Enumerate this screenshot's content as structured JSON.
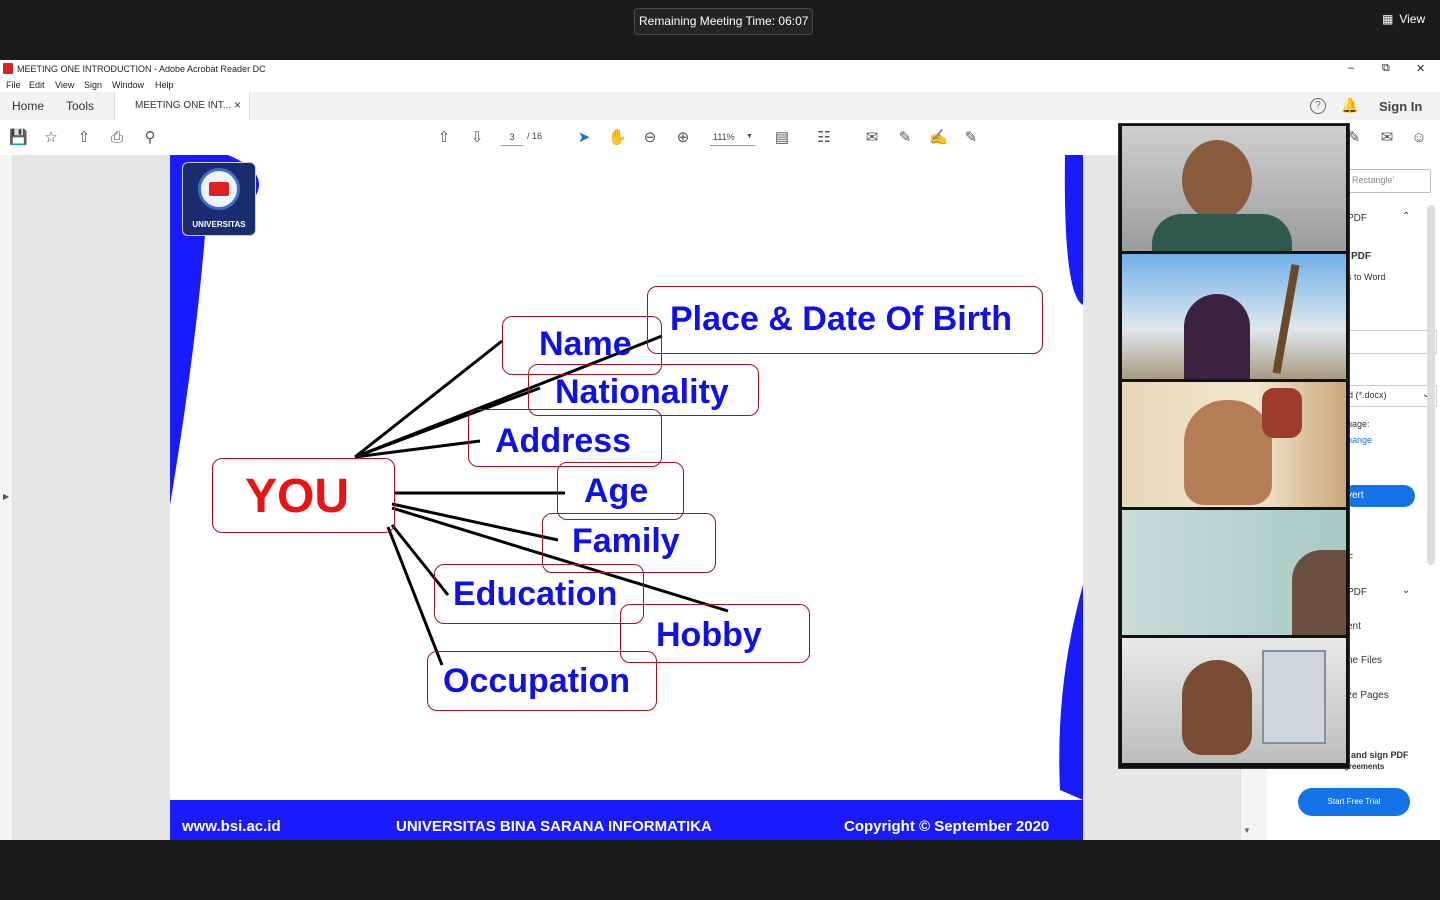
{
  "meeting": {
    "timer_text": "Remaining Meeting Time: 06:07",
    "view_label": "View"
  },
  "window": {
    "title": "MEETING ONE INTRODUCTION - Adobe Acrobat Reader DC",
    "controls": [
      "–",
      "⧉",
      "✕"
    ]
  },
  "menu": [
    "File",
    "Edit",
    "View",
    "Sign",
    "Window",
    "Help"
  ],
  "tabs": {
    "home": "Home",
    "tools": "Tools",
    "document": "MEETING ONE INT...",
    "close": "×"
  },
  "header_right": {
    "sign_in": "Sign In"
  },
  "toolbar": {
    "page_current": "3",
    "page_total": "/ 16",
    "zoom": "111%"
  },
  "slide": {
    "logo_text": "UNIVERSITAS",
    "center_label": "YOU",
    "branches": [
      "Place & Date Of Birth",
      "Name",
      "Nationality",
      "Address",
      "Age",
      "Family",
      "Education",
      "Hobby",
      "Occupation"
    ],
    "footer_url": "www.bsi.ac.id",
    "footer_university": "UNIVERSITAS BINA SARANA INFORMATIKA",
    "footer_copyright": "Copyright © September 2020"
  },
  "right_panel": {
    "search_placeholder": "Rectangle'",
    "items": [
      "PDF",
      "PDF",
      "s to Word",
      "d (*.docx)",
      "uage:",
      "hange",
      "vert",
      "F",
      "PDF",
      "ent",
      "ne Files",
      "ze Pages"
    ],
    "promo_title": "and sign PDF",
    "promo_sub": "forms & agreements",
    "trial_button": "Start Free Trial"
  },
  "colors": {
    "slide_blue": "#1a1aff",
    "label_blue": "#1010e8",
    "you_red": "#ee1111",
    "bubble_border": "#a0141e",
    "adobe_blue": "#1473e6"
  }
}
